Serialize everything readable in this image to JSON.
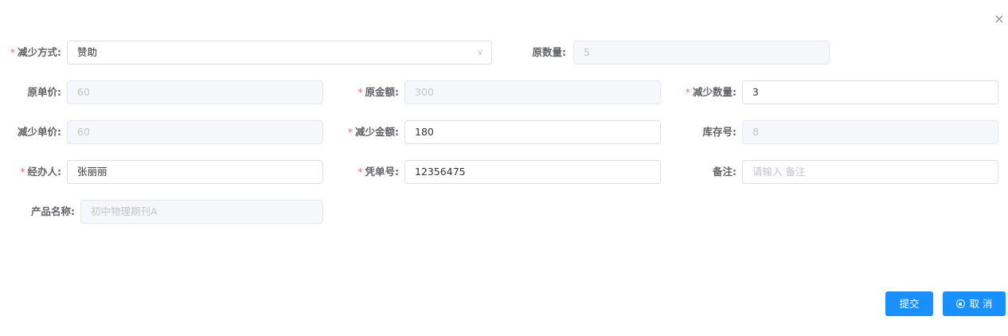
{
  "dialog": {
    "close_glyph": "×"
  },
  "form": {
    "reduce_method": {
      "label": "减少方式:",
      "value": "赞助"
    },
    "original_quantity": {
      "label": "原数量:",
      "value": "5"
    },
    "original_unit_price": {
      "label": "原单价:",
      "value": "60"
    },
    "original_amount": {
      "label": "原金额:",
      "value": "300"
    },
    "reduce_quantity": {
      "label": "减少数量:",
      "value": "3"
    },
    "reduce_unit_price": {
      "label": "减少单价:",
      "value": "60"
    },
    "reduce_amount": {
      "label": "减少金额:",
      "value": "180"
    },
    "stock_number": {
      "label": "库存号:",
      "value": "8"
    },
    "handler": {
      "label": "经办人:",
      "value": "张丽丽"
    },
    "voucher_number": {
      "label": "凭单号:",
      "value": "12356475"
    },
    "remark": {
      "label": "备注:",
      "value": "",
      "placeholder": "请输入 备注"
    },
    "product_name": {
      "label": "产品名称:",
      "value": "初中物理期刊A"
    }
  },
  "actions": {
    "submit_label": "提交",
    "cancel_label": "取 消"
  },
  "colors": {
    "primary": "#1890ff",
    "required": "#f56c6c",
    "disabled_bg": "#f5f7fa"
  },
  "icons": {
    "close": "close-icon",
    "dropdown": "chevron-down-icon",
    "cancel": "circle-dot-icon"
  }
}
